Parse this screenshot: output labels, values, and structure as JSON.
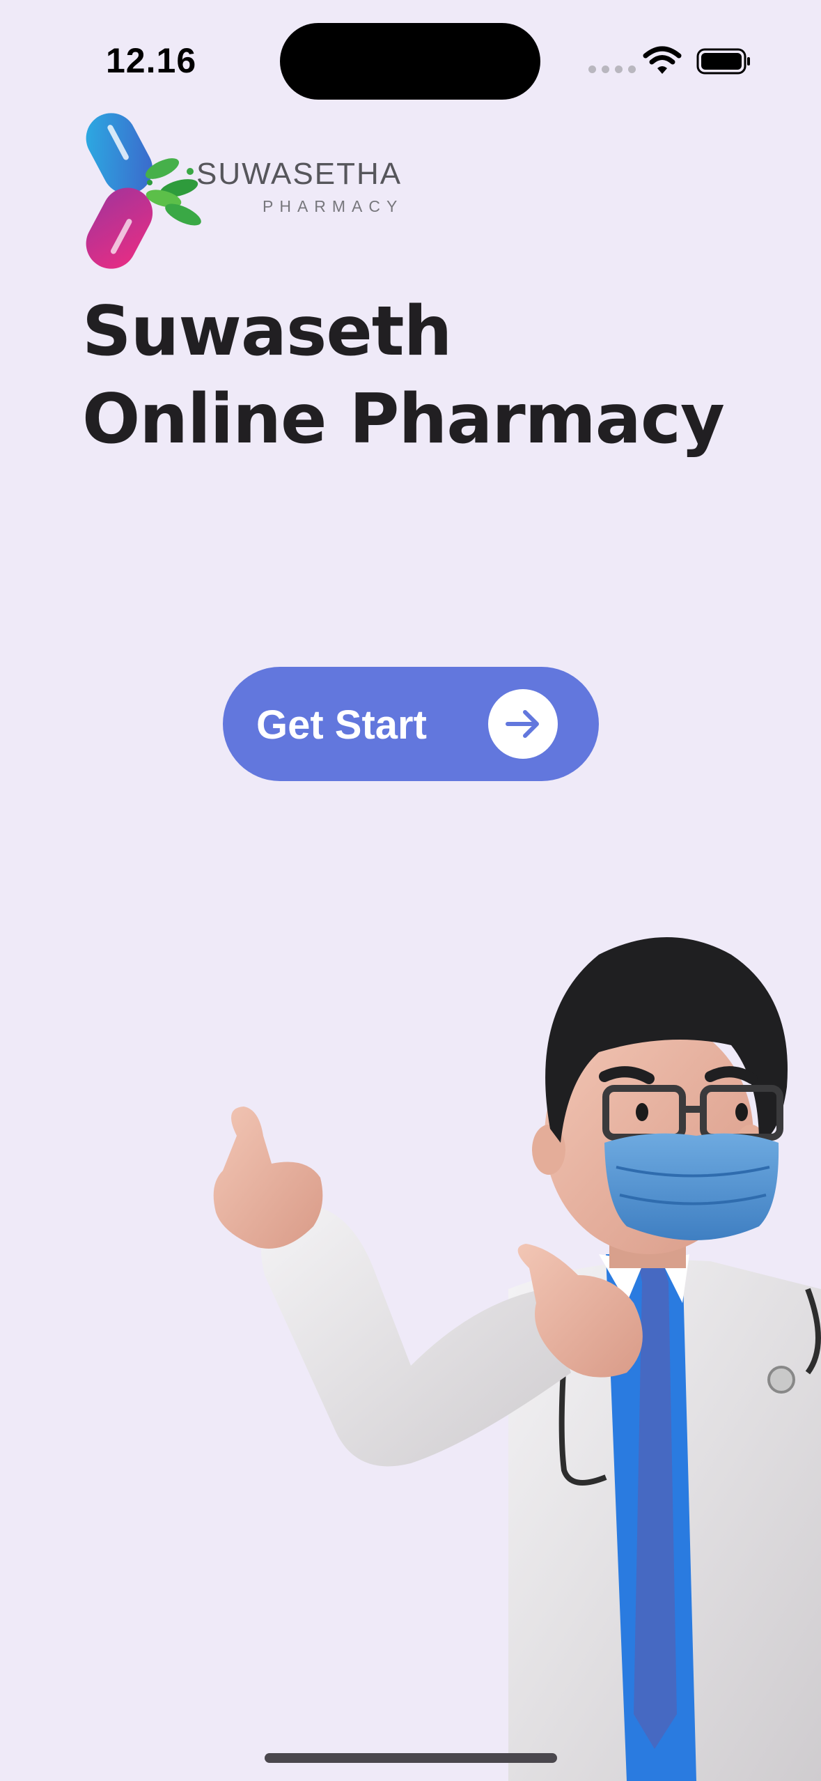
{
  "status_bar": {
    "time": "12.16",
    "icons": [
      "cellular-signal-icon",
      "wifi-icon",
      "battery-icon"
    ]
  },
  "brand": {
    "name": "SUWASETHA",
    "subtitle": "PHARMACY",
    "colors": {
      "capsule_top": "#2aa6dc",
      "capsule_bottom": "#e0338e",
      "leaf": "#3aa845"
    }
  },
  "headline": {
    "line1": "Suwaseth",
    "line2": "Online Pharmacy"
  },
  "cta": {
    "label": "Get Start",
    "icon": "arrow-right-icon",
    "color": "#6277dd"
  },
  "illustration": {
    "icon": "doctor-illustration"
  }
}
